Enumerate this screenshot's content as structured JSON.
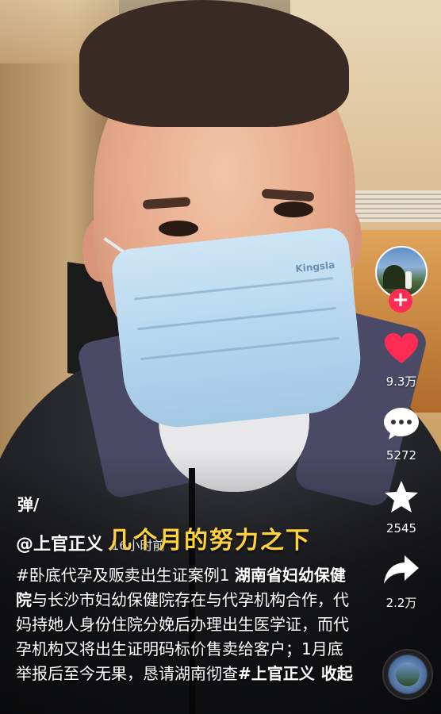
{
  "author": {
    "handle": "@上官正义",
    "time": "16小时前"
  },
  "subtitle": "几个月的努力之下",
  "danmu_label": "弹",
  "description": {
    "part1": "#卧底代孕及贩卖出生证案例1 ",
    "highlight": "湖南省妇幼保健院",
    "part2": "与长沙市妇幼保健院存在与代孕机构合作，代妈持她人身份住院分娩后办理出生医学证，而代孕机构又将出生证明码标价售卖给客户；1月底举报后至今无果，恳请湖南彻查",
    "tag": "#上官正义",
    "collapse": "收起"
  },
  "mask_brand": "Kingsla",
  "rail": {
    "likes": "9.3万",
    "comments": "5272",
    "favorites": "2545",
    "shares": "2.2万"
  },
  "colors": {
    "like": "#fe2c55",
    "subtitle": "#ffd23a",
    "follow": "#fe2c55"
  },
  "icons": [
    "avatar",
    "plus-icon",
    "heart-icon",
    "comment-icon",
    "star-icon",
    "share-icon",
    "music-disc"
  ]
}
